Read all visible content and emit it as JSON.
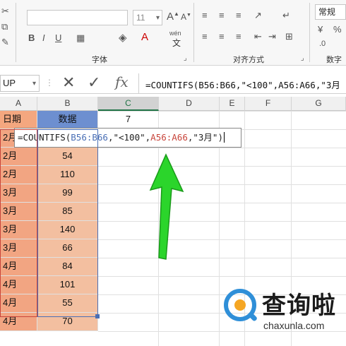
{
  "ribbon": {
    "font_size": "11",
    "group_font": "字体",
    "group_align": "对齐方式",
    "group_number": "数字",
    "number_format": "常规",
    "wen_label": "wén",
    "wen_sub": "文"
  },
  "formula_bar": {
    "name_box": "UP",
    "cancel_icon": "✕",
    "confirm_icon": "✓",
    "fx_label": "fx",
    "formula": "=COUNTIFS(B56:B66,\"<100\",A56:A66,\"3月"
  },
  "columns": [
    "A",
    "B",
    "C",
    "D",
    "E",
    "F",
    "G"
  ],
  "headers": {
    "a": "日期",
    "b": "数据",
    "c": "7"
  },
  "editing": {
    "row_partial": "2月",
    "prefix": "=COUNTIFS(",
    "range1": "B56:B66",
    "mid1": ",\"<100\",",
    "range2": "A56:A66",
    "suffix": ",\"3月\")"
  },
  "rows": [
    {
      "a": "2月",
      "b": "54"
    },
    {
      "a": "2月",
      "b": "110"
    },
    {
      "a": "3月",
      "b": "99"
    },
    {
      "a": "3月",
      "b": "85"
    },
    {
      "a": "3月",
      "b": "140"
    },
    {
      "a": "3月",
      "b": "66"
    },
    {
      "a": "4月",
      "b": "84"
    },
    {
      "a": "4月",
      "b": "101"
    },
    {
      "a": "4月",
      "b": "55"
    },
    {
      "a": "4月",
      "b": "70"
    }
  ],
  "watermark": {
    "brand": "查询啦",
    "url": "chaxunla.com"
  },
  "colors": {
    "arrow": "#2bd52b",
    "range1": "#4a6fb5",
    "range2": "#c8453b",
    "date_fill": "#f2a582",
    "data_fill": "#f3bfa0"
  }
}
